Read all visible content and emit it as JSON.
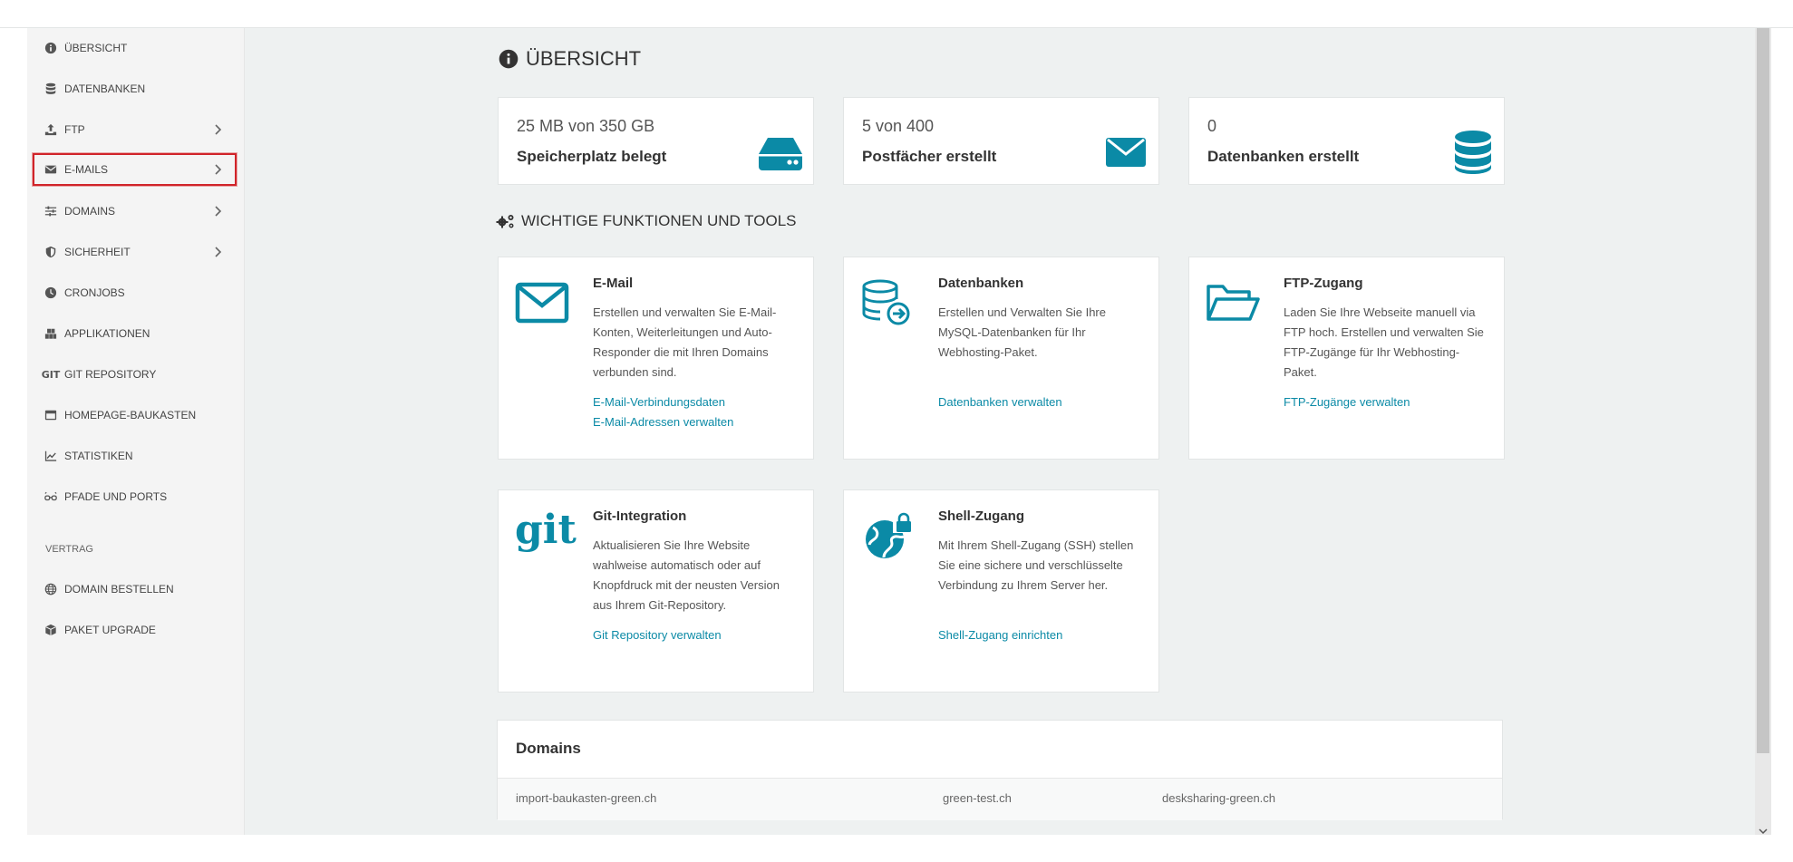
{
  "sidebar": {
    "items": [
      {
        "label": "ÜBERSICHT",
        "icon": "info-circle-icon"
      },
      {
        "label": "DATENBANKEN",
        "icon": "database-icon"
      },
      {
        "label": "FTP",
        "icon": "upload-icon"
      },
      {
        "label": "E-MAILS",
        "icon": "envelope-icon"
      },
      {
        "label": "DOMAINS",
        "icon": "sliders-icon"
      },
      {
        "label": "SICHERHEIT",
        "icon": "shield-icon"
      },
      {
        "label": "CRONJOBS",
        "icon": "clock-icon"
      },
      {
        "label": "APPLIKATIONEN",
        "icon": "cubes-icon"
      },
      {
        "label": "GIT REPOSITORY",
        "icon": "git-icon"
      },
      {
        "label": "HOMEPAGE-BAUKASTEN",
        "icon": "window-icon"
      },
      {
        "label": "STATISTIKEN",
        "icon": "chart-line-icon"
      },
      {
        "label": "PFADE UND PORTS",
        "icon": "glasses-icon"
      }
    ],
    "section_label": "VERTRAG",
    "contract_items": [
      {
        "label": "DOMAIN BESTELLEN",
        "icon": "globe-icon"
      },
      {
        "label": "PAKET UPGRADE",
        "icon": "box-icon"
      }
    ]
  },
  "main": {
    "title": "ÜBERSICHT",
    "stats": [
      {
        "value": "25 MB von 350 GB",
        "label": "Speicherplatz belegt",
        "icon": "hdd-icon"
      },
      {
        "value": "5 von 400",
        "label": "Postfächer erstellt",
        "icon": "envelope-icon"
      },
      {
        "value": "0",
        "label": "Datenbanken erstellt",
        "icon": "database-icon"
      }
    ],
    "tools_title": "WICHTIGE FUNKTIONEN UND TOOLS",
    "tools": [
      {
        "title": "E-Mail",
        "description": "Erstellen und verwalten Sie E-Mail-Konten, Weiterleitungen und Auto-Responder die mit Ihren Domains verbunden sind.",
        "links": [
          "E-Mail-Verbindungsdaten",
          "E-Mail-Adressen verwalten"
        ],
        "icon": "envelope-outline-icon"
      },
      {
        "title": "Datenbanken",
        "description": "Erstellen und Verwalten Sie Ihre MySQL-Datenbanken für Ihr Webhosting-Paket.",
        "links": [
          "Datenbanken verwalten"
        ],
        "icon": "database-arrow-icon"
      },
      {
        "title": "FTP-Zugang",
        "description": "Laden Sie Ihre Webseite manuell via FTP hoch. Erstellen und verwalten Sie FTP-Zugänge für Ihr Webhosting-Paket.",
        "links": [
          "FTP-Zugänge verwalten"
        ],
        "icon": "folder-open-icon"
      },
      {
        "title": "Git-Integration",
        "description": "Aktualisieren Sie Ihre Website wahlweise automatisch oder auf Knopfdruck mit der neusten Version aus Ihrem Git-Repository.",
        "links": [
          "Git Repository verwalten"
        ],
        "icon": "git-logo-icon",
        "icon_text": "git"
      },
      {
        "title": "Shell-Zugang",
        "description": "Mit Ihrem Shell-Zugang (SSH) stellen Sie eine sichere und verschlüsselte Verbindung zu Ihrem Server her.",
        "links": [
          "Shell-Zugang einrichten"
        ],
        "icon": "globe-lock-icon"
      }
    ],
    "domains": {
      "title": "Domains",
      "items": [
        "import-baukasten-green.ch",
        "green-test.ch",
        "desksharing-green.ch"
      ]
    }
  },
  "colors": {
    "accent": "#0b8aa6",
    "selection": "#d0242a",
    "sidebar_bg": "#f4f4f4",
    "main_bg": "#eef1f1"
  }
}
